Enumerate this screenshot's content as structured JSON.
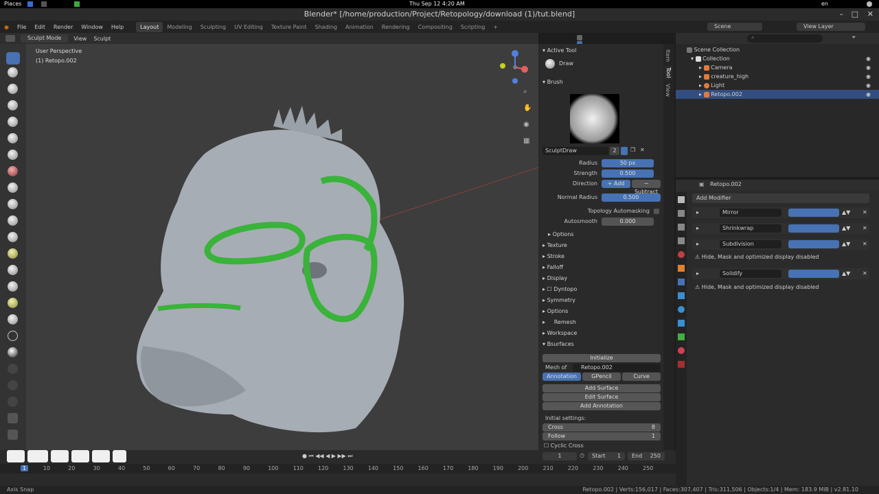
{
  "system": {
    "places": "Places",
    "clock": "Thu Sep 12  4:20 AM",
    "lang": "en"
  },
  "window": {
    "title": "Blender* [/home/production/Project/Retopology/download (1)/tut.blend]"
  },
  "menu": [
    "File",
    "Edit",
    "Render",
    "Window",
    "Help"
  ],
  "workspaces": [
    "Layout",
    "Modeling",
    "Sculpting",
    "UV Editing",
    "Texture Paint",
    "Shading",
    "Animation",
    "Rendering",
    "Compositing",
    "Scripting",
    "+"
  ],
  "workspace_active": "Layout",
  "viewport_header": {
    "mode": "Sculpt Mode",
    "view": "View",
    "sculpt": "Sculpt"
  },
  "viewport": {
    "perspective": "User Perspective",
    "object": "(1) Retopo.002"
  },
  "npanel": {
    "tabs": [
      "Item",
      "Tool",
      "View"
    ],
    "active_tool_header": "Active Tool",
    "tool_name": "Draw",
    "brush_header": "Brush",
    "brush_name": "SculptDraw",
    "brush_users": "2",
    "radius_label": "Radius",
    "radius": "50 px",
    "strength_label": "Strength",
    "strength": "0.500",
    "direction_label": "Direction",
    "add": "Add",
    "subtract": "Subtract",
    "normal_radius_label": "Normal Radius",
    "normal_radius": "0.500",
    "topology_automasking": "Topology Automasking",
    "autosmooth_label": "Autosmooth",
    "autosmooth": "0.000",
    "options_sub": "Options",
    "sections": [
      "Texture",
      "Stroke",
      "Falloff",
      "Display",
      "Dyntopo",
      "Symmetry",
      "Options",
      "Remesh",
      "Workspace",
      "Bsurfaces"
    ],
    "initialize": "Initialize",
    "mesh_label": "Mesh of B...",
    "mesh_value": "Retopo.002",
    "bs_tabs": [
      "Annotation",
      "GPencil",
      "Curve"
    ],
    "add_surface": "Add Surface",
    "edit_surface": "Edit Surface",
    "add_annotation": "Add Annotation",
    "initial_settings": "Initial settings:",
    "cross_label": "Cross",
    "cross": "8",
    "follow_label": "Follow",
    "follow": "1",
    "cyclic_cross": "Cyclic Cross"
  },
  "outliner": {
    "scene": "Scene",
    "view_layer": "View Layer",
    "items": [
      "Scene Collection",
      "Collection",
      "Camera",
      "creature_high",
      "Light",
      "Retopo.002"
    ]
  },
  "properties": {
    "object": "Retopo.002",
    "add_modifier": "Add Modifier",
    "modifiers": [
      "Mirror",
      "Shrinkwrap",
      "Subdivision",
      "Solidify"
    ],
    "warning": "Hide, Mask and optimized display disabled"
  },
  "timeline": {
    "frame": "1",
    "start_label": "Start",
    "start": "1",
    "end_label": "End",
    "end": "250",
    "ticks": [
      "1",
      "10",
      "20",
      "30",
      "40",
      "50",
      "60",
      "70",
      "80",
      "90",
      "100",
      "110",
      "120",
      "130",
      "140",
      "150",
      "160",
      "170",
      "180",
      "190",
      "200",
      "210",
      "220",
      "230",
      "240",
      "250"
    ]
  },
  "status": {
    "left": "Axis Snap",
    "right": "Retopo.002 | Verts:156,017 | Faces:307,407 | Tris:311,506 | Objects:1/4 | Mem: 183.9 MiB | v2.81.10"
  },
  "colors": {
    "accent": "#4772b3",
    "green": "#39b339",
    "mesh": "#a7adb4"
  }
}
